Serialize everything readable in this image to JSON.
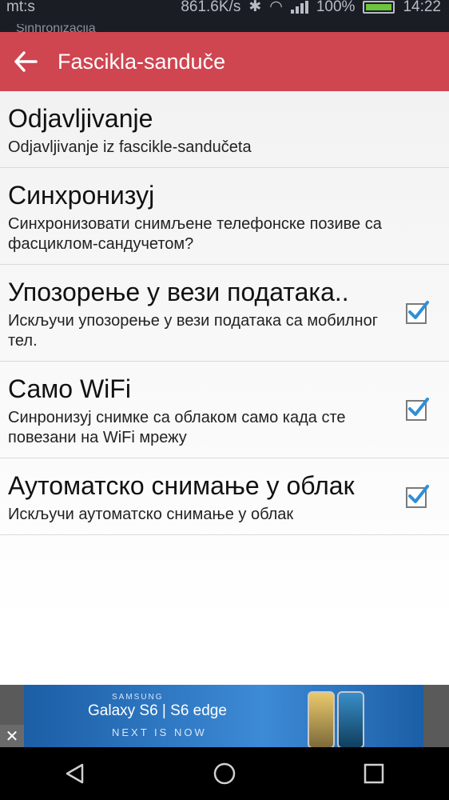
{
  "status_bar": {
    "carrier": "mt:s",
    "speed": "861.6K/s",
    "battery": "100%",
    "time": "14:22",
    "notification_peek": "Sinhronizacija"
  },
  "app_bar": {
    "title": "Fascikla-sanduče",
    "back_icon": "arrow-left-icon",
    "background": "#cf4550"
  },
  "settings": [
    {
      "title": "Odjavljivanje",
      "subtitle": "Odjavljivanje iz fascikle-sandučeta",
      "has_checkbox": false
    },
    {
      "title": "Синхронизуј",
      "subtitle": "Синхронизовати снимљене телефонске позиве са фасциклом-сандучетом?",
      "has_checkbox": false
    },
    {
      "title": "Упозорење у вези података..",
      "subtitle": "Искључи упозорење у вези података са мобилног тел.",
      "has_checkbox": true,
      "checked": true
    },
    {
      "title": "Само WiFi",
      "subtitle": "Синронизуј снимке са облаком само када сте повезани на WiFi мрежу",
      "has_checkbox": true,
      "checked": true
    },
    {
      "title": "Аутоматско снимање у облак",
      "subtitle": "Искључи аутоматско снимање у облак",
      "has_checkbox": true,
      "checked": true
    }
  ],
  "ad": {
    "brand": "SAMSUNG",
    "model": "Galaxy S6 | S6 edge",
    "tagline": "NEXT IS NOW",
    "close_label": "✕"
  },
  "nav_bar": {
    "back_icon": "triangle-back-icon",
    "home_icon": "circle-home-icon",
    "recents_icon": "square-recents-icon"
  }
}
